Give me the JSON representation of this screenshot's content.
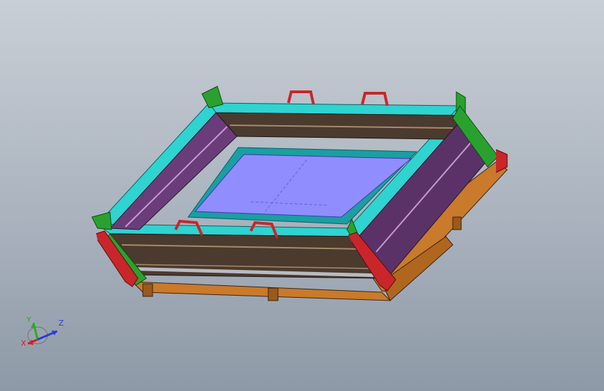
{
  "viewport": {
    "background_top": "#c9cfd6",
    "background_bottom": "#8e99a7"
  },
  "model": {
    "colors": {
      "frame_cyan": "#2fd3d0",
      "frame_cyan_dark": "#1a9fa3",
      "wall_purple": "#6a3d7a",
      "wall_purple_light": "#9b58ad",
      "wall_brown": "#4b3a2e",
      "floor_blue": "#8f8dff",
      "corner_green": "#2aa12f",
      "handle_red": "#c8262a",
      "base_orange": "#c97a2a",
      "rod_gray": "#b7bcc4"
    }
  },
  "triad": {
    "x_label": "X",
    "y_label": "Y",
    "z_label": "Z",
    "x_color": "#d62020",
    "y_color": "#22b022",
    "z_color": "#2240d8"
  }
}
